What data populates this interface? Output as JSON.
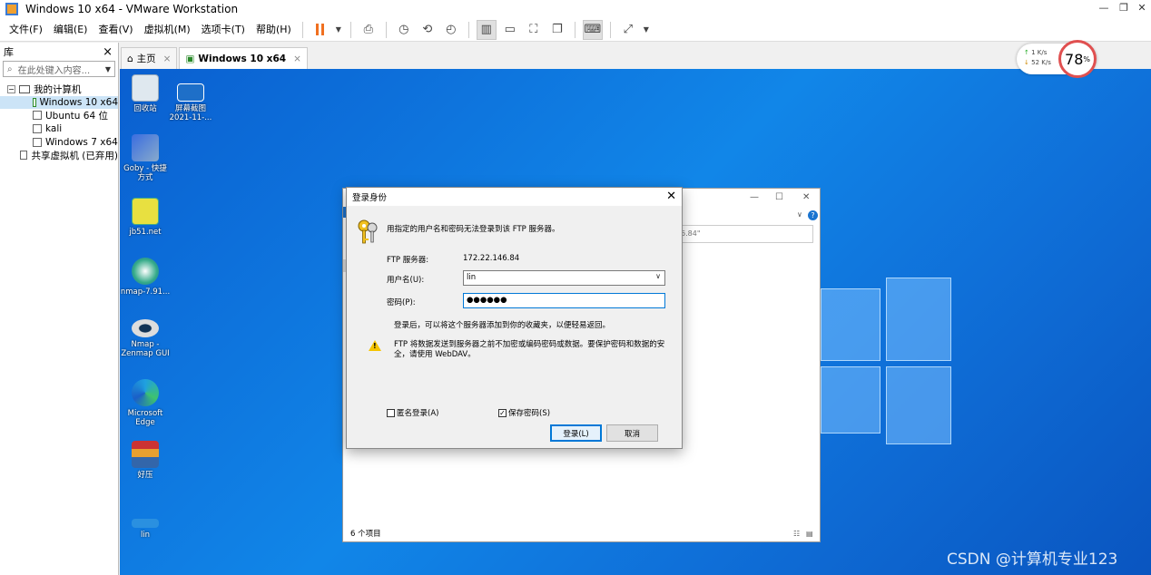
{
  "window": {
    "title": "Windows 10 x64 - VMware Workstation",
    "min": "—",
    "restore": "❐",
    "close": "✕"
  },
  "menu": [
    "文件(F)",
    "编辑(E)",
    "查看(V)",
    "虚拟机(M)",
    "选项卡(T)",
    "帮助(H)"
  ],
  "library": {
    "title": "库",
    "close": "×",
    "search_placeholder": "在此处键入内容...",
    "root": "我的计算机",
    "vms": [
      "Windows 10 x64",
      "Ubuntu 64 位",
      "kali",
      "Windows 7 x64"
    ],
    "shared": "共享虚拟机 (已弃用)"
  },
  "tabs": {
    "home": "主页",
    "vm": "Windows 10 x64"
  },
  "net": {
    "up_rate": "1  K/s",
    "down_rate": "52  K/s",
    "percent": "78",
    "percent_unit": "%"
  },
  "desktop_icons": {
    "recycle": "回收站",
    "screenshot": "屏幕截图 2021-11-...",
    "goby": "Goby - 快捷方式",
    "jb51": "jb51.net",
    "nmap791": "nmap-7.91...",
    "zenmap": "Nmap - Zenmap GUI",
    "edge": "Microsoft Edge",
    "winrar": "好压",
    "lin": "lin"
  },
  "explorer": {
    "address_fragment": "6.84\"",
    "status": "6 个项目",
    "min": "—",
    "max": "☐",
    "close": "✕",
    "help": "?"
  },
  "dialog": {
    "title": "登录身份",
    "close": "✕",
    "message": "用指定的用户名和密码无法登录到该 FTP 服务器。",
    "server_label": "FTP 服务器:",
    "server_value": "172.22.146.84",
    "username_label": "用户名(U):",
    "username_value": "lin",
    "password_label": "密码(P):",
    "password_value": "●●●●●●",
    "info": "登录后，可以将这个服务器添加到你的收藏夹，以便轻易返回。",
    "warning": "FTP 将数据发送到服务器之前不加密或编码密码或数据。要保护密码和数据的安全，请使用 WebDAV。",
    "anonymous": "匿名登录(A)",
    "save_password": "保存密码(S)",
    "login_button": "登录(L)",
    "cancel_button": "取消"
  },
  "watermark": "CSDN @计算机专业123"
}
